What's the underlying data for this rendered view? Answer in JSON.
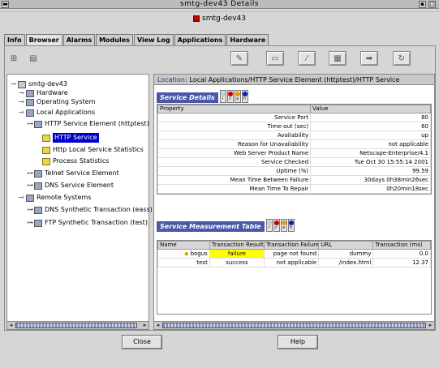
{
  "window": {
    "title": "smtg-dev43 Details",
    "host": "smtg-dev43"
  },
  "tabs": [
    "Info",
    "Browser",
    "Alarms",
    "Modules",
    "View Log",
    "Applications",
    "Hardware"
  ],
  "active_tab": "Browser",
  "tree": [
    {
      "label": "smtg-dev43",
      "indent": 0,
      "icon": "host"
    },
    {
      "label": "Hardware",
      "indent": 1,
      "icon": "module"
    },
    {
      "label": "Operating System",
      "indent": 1,
      "icon": "module"
    },
    {
      "label": "Local Applications",
      "indent": 1,
      "icon": "module"
    },
    {
      "label": "HTTP Service Element (httptest)",
      "indent": 2,
      "icon": "module"
    },
    {
      "label": "HTTP Service",
      "indent": 3,
      "icon": "folder",
      "selected": true
    },
    {
      "label": "Http Local Service Statistics",
      "indent": 3,
      "icon": "folder"
    },
    {
      "label": "Process Statistics",
      "indent": 3,
      "icon": "folder"
    },
    {
      "label": "Telnet Service Element",
      "indent": 2,
      "icon": "module"
    },
    {
      "label": "DNS Service Element",
      "indent": 2,
      "icon": "module"
    },
    {
      "label": "Remote Systems",
      "indent": 1,
      "icon": "module"
    },
    {
      "label": "DNS Synthetic Transaction (eass)",
      "indent": 2,
      "icon": "module"
    },
    {
      "label": "FTP Synthetic Transaction (test)",
      "indent": 2,
      "icon": "module"
    }
  ],
  "location": {
    "label": "Location:",
    "path": "Local Applications/HTTP Service Element (httptest)/HTTP Service"
  },
  "service_details": {
    "title": "Service Details",
    "columns": [
      "Property",
      "Value"
    ],
    "rows": [
      [
        "Service Port",
        "80"
      ],
      [
        "Time-out (sec)",
        "60"
      ],
      [
        "Availability",
        "up"
      ],
      [
        "Reason for Unavailability",
        "not applicable"
      ],
      [
        "Web Server Product Name",
        "Netscape-Enterprise/4.1"
      ],
      [
        "Service Checked",
        "Tue Oct 30 15:55:14 2001"
      ],
      [
        "Uptime (%)",
        "99.59"
      ],
      [
        "Mean Time Between Failure",
        "30days 0h38min26sec"
      ],
      [
        "Mean Time To Repair",
        "0h20min18sec"
      ]
    ]
  },
  "measurement_table": {
    "title": "Service Measurement Table",
    "columns": [
      "Name",
      "Transaction Result",
      "Transaction Failure",
      "URL",
      "Transaction (ms)"
    ],
    "rows": [
      {
        "name": "bogus",
        "result": "failure",
        "failure": "page not found",
        "url": "dummy",
        "ms": "0.0",
        "warn": true
      },
      {
        "name": "test",
        "result": "success",
        "failure": "not applicable",
        "url": "/index.html",
        "ms": "12.37",
        "warn": false
      }
    ]
  },
  "severity_labels": [
    "i",
    "c",
    "a",
    "h"
  ],
  "colors": {
    "selection": "#0000c8",
    "section_title": "#4a58a8",
    "failure_cell": "#ffff00"
  },
  "buttons": {
    "close": "Close",
    "help": "Help"
  }
}
